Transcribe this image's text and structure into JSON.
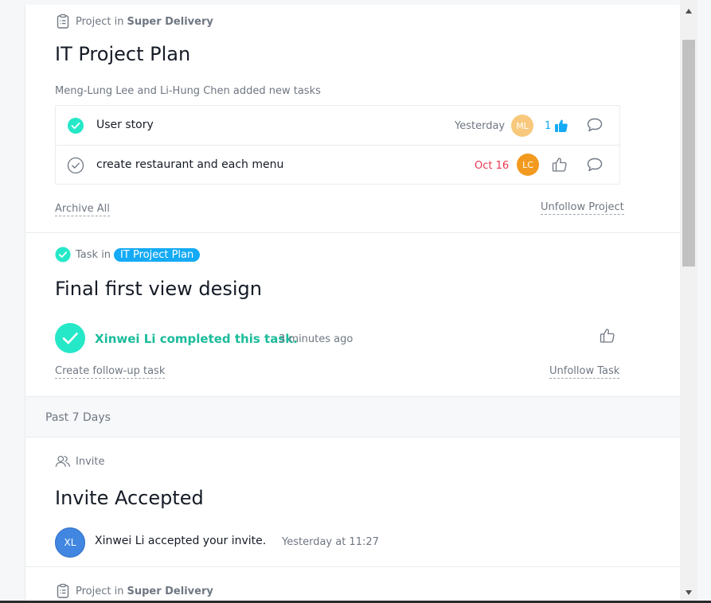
{
  "cards": [
    {
      "context_prefix": "Project in",
      "context_project": "Super Delivery",
      "title": "IT Project Plan",
      "subtitle": "Meng-Lung Lee and Li-Hung Chen added new tasks",
      "tasks": [
        {
          "name": "User story",
          "due": "Yesterday",
          "due_color": "#6f7782",
          "completed": true,
          "avatar_initials": "ML",
          "avatar_color": "#f8c97c",
          "likes": "1",
          "liked": true
        },
        {
          "name": "create restaurant and each menu",
          "due": "Oct 16",
          "due_color": "#e8384f",
          "completed": false,
          "avatar_initials": "LC",
          "avatar_color": "#f29a1f",
          "likes": "",
          "liked": false
        }
      ],
      "left_action": "Archive All",
      "right_action": "Unfollow Project"
    },
    {
      "context_prefix": "Task in",
      "context_project": "IT Project Plan",
      "title": "Final first view design",
      "actor": "Xinwei Li completed this task.",
      "time": "3 minutes ago",
      "left_action": "Create follow-up task",
      "right_action": "Unfollow Task"
    },
    {
      "section_header": "Past 7 Days"
    },
    {
      "context_prefix": "Invite",
      "title": "Invite Accepted",
      "avatar_initials": "XL",
      "avatar_color": "#4186e0",
      "actor": "Xinwei Li accepted your invite.",
      "time": "Yesterday at 11:27"
    },
    {
      "context_prefix": "Project in",
      "context_project": "Super Delivery"
    }
  ],
  "colors": {
    "accent_teal": "#25e8c8",
    "teal_text": "#1bbc9b",
    "blue": "#14aaf5",
    "overdue_red": "#e8384f"
  }
}
